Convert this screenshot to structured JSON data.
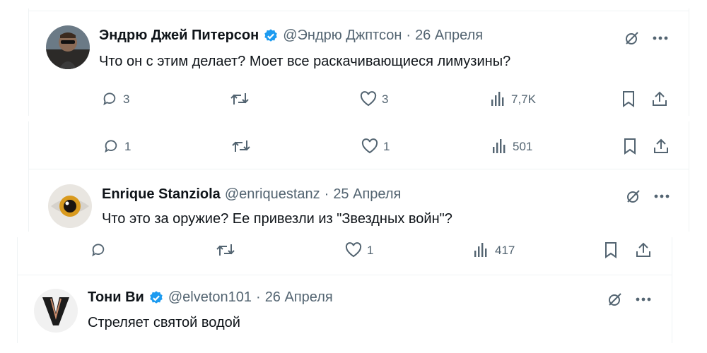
{
  "replies": [
    {
      "author": "Эндрю Джей Питерсон",
      "verified": true,
      "handle": "@Эндрю Джптсон",
      "separator": "·",
      "date": "26 Апреля",
      "text": "Что он с этим делает? Моет все раскачивающиеся лимузины?",
      "stats": {
        "replies": "3",
        "retweets": "",
        "likes": "3",
        "views": "7,7K"
      }
    },
    {
      "stats": {
        "replies": "1",
        "retweets": "",
        "likes": "1",
        "views": "501"
      }
    },
    {
      "author": "Enrique Stanziola",
      "verified": false,
      "handle": "@enriquestanz",
      "separator": "·",
      "date": "25 Апреля",
      "text": "Что это за оружие?  Ее привезли из \"Звездных войн\"?",
      "stats": {
        "replies": "",
        "retweets": "",
        "likes": "1",
        "views": "417"
      }
    },
    {
      "author": "Тони Ви",
      "verified": true,
      "handle": "@elveton101",
      "separator": "·",
      "date": "26 Апреля",
      "text": "Стреляет святой водой"
    }
  ],
  "colors": {
    "text_primary": "#0f1419",
    "text_secondary": "#536471",
    "verified_blue": "#1d9bf0",
    "divider": "#eff3f4"
  },
  "icons": [
    "reply-icon",
    "retweet-icon",
    "like-icon",
    "views-icon",
    "bookmark-icon",
    "share-icon",
    "grok-icon",
    "more-icon",
    "verified-badge-icon"
  ]
}
